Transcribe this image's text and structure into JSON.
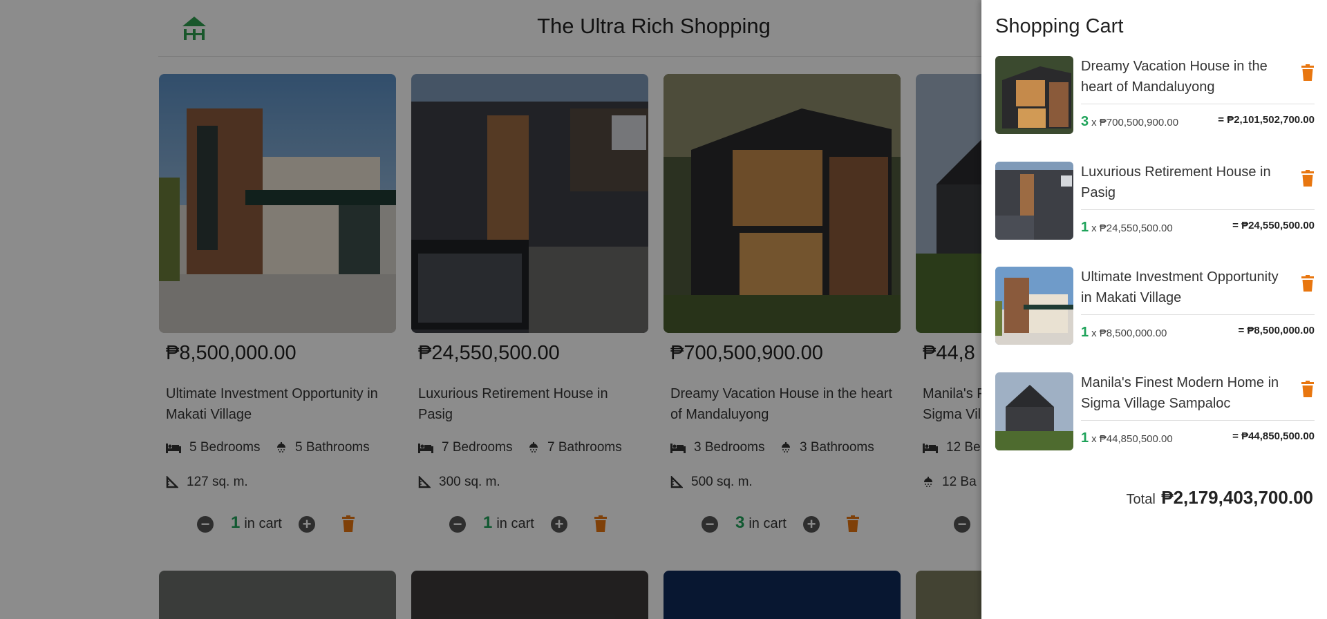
{
  "site": {
    "title": "The Ultra Rich Shopping",
    "logo_icon": "house-logo-icon",
    "accent": "#2e9e4f"
  },
  "listings": [
    {
      "price": "₱8,500,000.00",
      "name": "Ultimate Investment Opportunity in Makati Village",
      "bedrooms": "5 Bedrooms",
      "bathrooms": "5 Bathrooms",
      "area": "127 sq. m.",
      "qty": "1",
      "in_cart_label": "in cart"
    },
    {
      "price": "₱24,550,500.00",
      "name": "Luxurious Retirement House in Pasig",
      "bedrooms": "7 Bedrooms",
      "bathrooms": "7 Bathrooms",
      "area": "300 sq. m.",
      "qty": "1",
      "in_cart_label": "in cart"
    },
    {
      "price": "₱700,500,900.00",
      "name": "Dreamy Vacation House in the heart of Mandaluyong",
      "bedrooms": "3 Bedrooms",
      "bathrooms": "3 Bathrooms",
      "area": "500 sq. m.",
      "qty": "3",
      "in_cart_label": "in cart"
    },
    {
      "price": "₱44,8",
      "name_line1": "Manila's F",
      "name_line2": "Sigma Vil",
      "bedrooms": "12 Be",
      "bathrooms": "12 Ba"
    }
  ],
  "cart": {
    "title": "Shopping Cart",
    "items": [
      {
        "name": "Dreamy Vacation House in the heart of Mandaluyong",
        "qty": "3",
        "unit": "x ₱700,500,900.00",
        "subtotal": "= ₱2,101,502,700.00"
      },
      {
        "name": "Luxurious Retirement House in Pasig",
        "qty": "1",
        "unit": "x ₱24,550,500.00",
        "subtotal": "= ₱24,550,500.00"
      },
      {
        "name": "Ultimate Investment Opportunity in Makati Village",
        "qty": "1",
        "unit": "x ₱8,500,000.00",
        "subtotal": "= ₱8,500,000.00"
      },
      {
        "name": "Manila's Finest Modern Home in Sigma Village Sampaloc",
        "qty": "1",
        "unit": "x ₱44,850,500.00",
        "subtotal": "= ₱44,850,500.00"
      }
    ],
    "total_label": "Total",
    "total_value": "₱2,179,403,700.00"
  },
  "colors": {
    "trash": "#e8760f",
    "qty_green": "#1fa35a",
    "overlay": "rgba(0,0,0,0.45)"
  },
  "icons": {
    "remove": "minus-circle-icon",
    "add": "plus-circle-icon",
    "delete": "trash-icon",
    "bed": "bed-icon",
    "bath": "shower-icon",
    "area": "ruler-triangle-icon"
  }
}
